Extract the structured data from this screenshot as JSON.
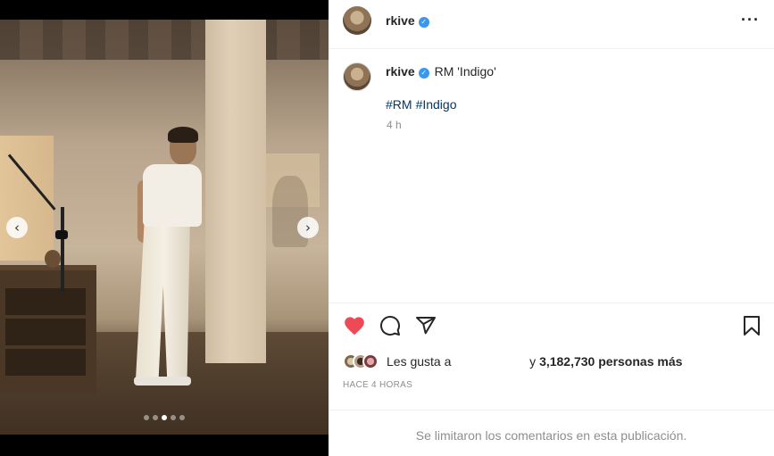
{
  "media": {
    "prev_glyph": "‹",
    "next_glyph": "›",
    "dots": 5,
    "active_dot": 2
  },
  "header": {
    "username": "rkive",
    "verified_glyph": "✓",
    "more_glyph": "···"
  },
  "caption": {
    "username": "rkive",
    "text": "RM 'Indigo'",
    "hashtags": [
      "#RM",
      "#Indigo"
    ],
    "time": "4 h"
  },
  "actions": {
    "liked": true,
    "like_color": "#ed4956"
  },
  "likes": {
    "prefix": "Les gusta a",
    "suffix": "y",
    "count": "3,182,730 personas más"
  },
  "posted_time": "HACE 4 HORAS",
  "comments_limited": "Se limitaron los comentarios en esta publicación."
}
